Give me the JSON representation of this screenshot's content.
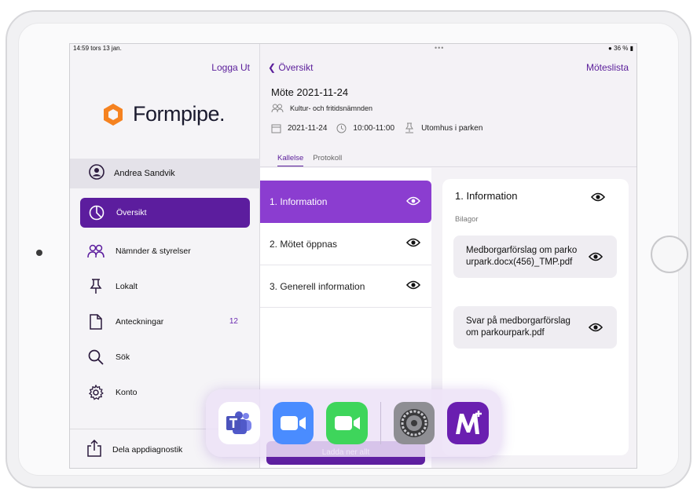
{
  "status": {
    "time_date": "14:59  tors 13 jan.",
    "dots": "•••",
    "battery": "36 %"
  },
  "sidebar": {
    "logout": "Logga Ut",
    "logo_text": "Formpipe.",
    "user_name": "Andrea Sandvik",
    "nav": [
      {
        "label": "Översikt",
        "icon": "pie-chart-icon",
        "active": true
      },
      {
        "label": "Nämnder & styrelser",
        "icon": "people-icon"
      },
      {
        "label": "Lokalt",
        "icon": "pin-icon"
      },
      {
        "label": "Anteckningar",
        "icon": "document-icon",
        "badge": "12"
      },
      {
        "label": "Sök",
        "icon": "search-icon"
      },
      {
        "label": "Konto",
        "icon": "gear-icon"
      }
    ],
    "share": "Dela appdiagnostik"
  },
  "header": {
    "back": "Översikt",
    "meetings_link": "Möteslista"
  },
  "meeting": {
    "title": "Möte 2021-11-24",
    "committee": "Kultur- och fritidsnämnden",
    "date": "2021-11-24",
    "time": "10:00-11:00",
    "location": "Utomhus i parken"
  },
  "tabs": [
    {
      "label": "Kallelse",
      "active": true
    },
    {
      "label": "Protokoll"
    }
  ],
  "agenda": [
    {
      "label": "1. Information",
      "active": true
    },
    {
      "label": "2. Mötet öppnas"
    },
    {
      "label": "3. Generell information"
    }
  ],
  "agenda_button": "Ladda ner allt",
  "detail": {
    "title": "1. Information",
    "attachments_label": "Bilagor",
    "attachments": [
      "Medborgarförslag om parkourpark.docx(456)_TMP.pdf",
      "Svar på medborgarförslag om parkourpark.pdf"
    ]
  },
  "dock": [
    "teams-icon",
    "zoom-icon",
    "facetime-icon",
    "settings-icon",
    "m-plus-icon"
  ],
  "colors": {
    "brand": "#5c1d9e",
    "accent": "#8b3dd0",
    "logo_orange": "#f58220"
  }
}
